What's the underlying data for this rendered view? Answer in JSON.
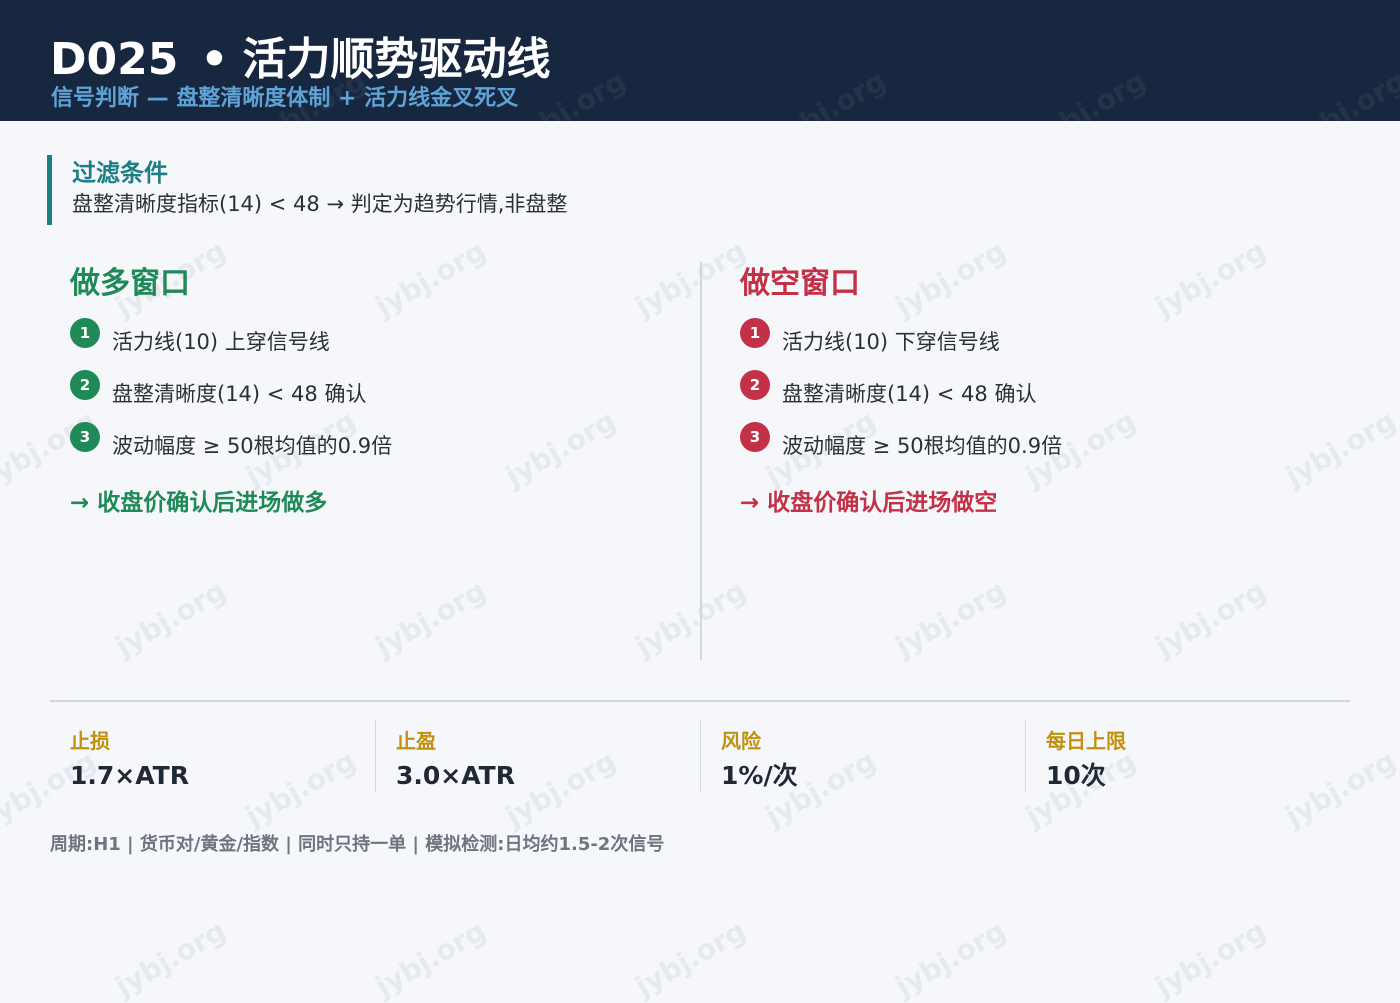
{
  "header": {
    "code": "D025",
    "separator": "•",
    "name": "活力顺势驱动线",
    "subtitle": "信号判断 — 盘整清晰度体制 + 活力线金叉死叉"
  },
  "filter": {
    "title": "过滤条件",
    "text": "盘整清晰度指标(14) < 48 → 判定为趋势行情,非盘整"
  },
  "long": {
    "title": "做多窗口",
    "conditions": [
      {
        "num": "1",
        "text": "活力线(10) 上穿信号线"
      },
      {
        "num": "2",
        "text": "盘整清晰度(14) < 48 确认"
      },
      {
        "num": "3",
        "text": "波动幅度 ≥ 50根均值的0.9倍"
      }
    ],
    "entry": "→ 收盘价确认后进场做多"
  },
  "short": {
    "title": "做空窗口",
    "conditions": [
      {
        "num": "1",
        "text": "活力线(10) 下穿信号线"
      },
      {
        "num": "2",
        "text": "盘整清晰度(14) < 48 确认"
      },
      {
        "num": "3",
        "text": "波动幅度 ≥ 50根均值的0.9倍"
      }
    ],
    "entry": "→ 收盘价确认后进场做空"
  },
  "stats": [
    {
      "label": "止损",
      "value": "1.7×ATR"
    },
    {
      "label": "止盈",
      "value": "3.0×ATR"
    },
    {
      "label": "风险",
      "value": "1%/次"
    },
    {
      "label": "每日上限",
      "value": "10次"
    }
  ],
  "footnote": "周期:H1 | 货币对/黄金/指数 | 同时只持一单 | 模拟检测:日均约1.5-2次信号",
  "watermark": "jybj.org",
  "colors": {
    "header_bg": "#17273f",
    "subtitle": "#5fa3d6",
    "filter_accent": "#1d7f86",
    "long": "#1f8a57",
    "short": "#c23147",
    "stat_label": "#c2900f"
  }
}
